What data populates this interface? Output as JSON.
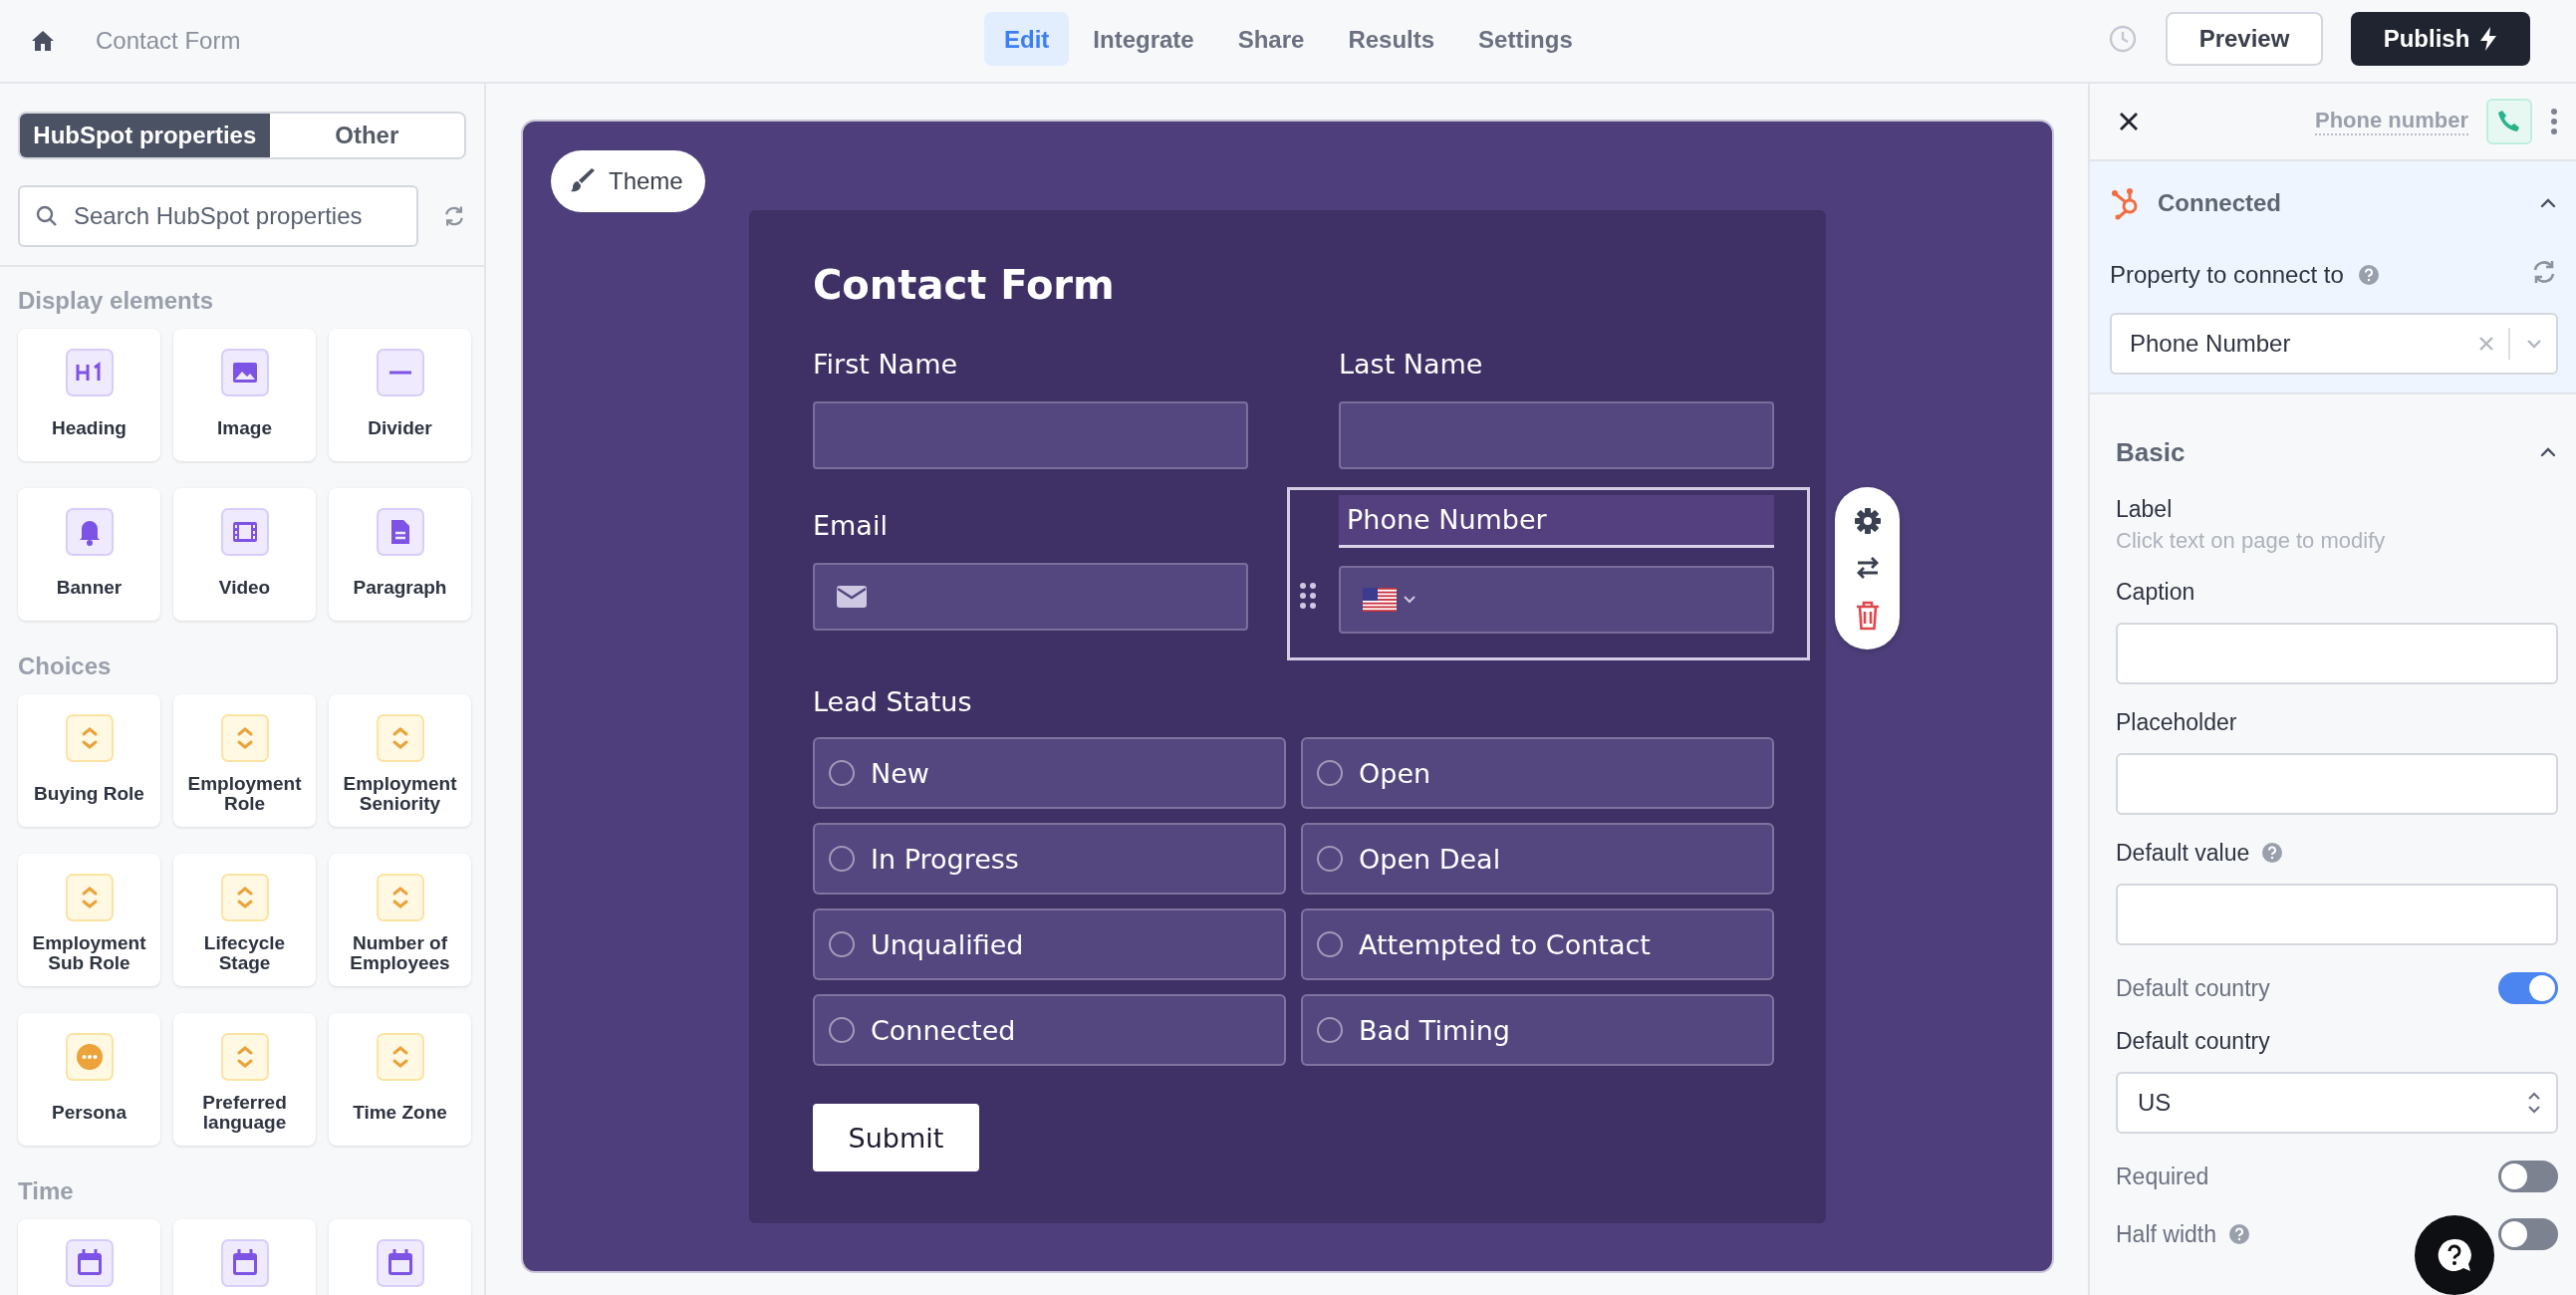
{
  "topbar": {
    "title": "Contact Form",
    "tabs": [
      {
        "label": "Edit",
        "selected": true
      },
      {
        "label": "Integrate",
        "selected": false
      },
      {
        "label": "Share",
        "selected": false
      },
      {
        "label": "Results",
        "selected": false
      },
      {
        "label": "Settings",
        "selected": false
      }
    ],
    "preview": "Preview",
    "publish": "Publish"
  },
  "sidebar": {
    "tabs": [
      {
        "label": "HubSpot properties",
        "selected": true
      },
      {
        "label": "Other",
        "selected": false
      }
    ],
    "search": {
      "placeholder": "Search HubSpot properties"
    },
    "sections": [
      {
        "title": "Display elements",
        "items": [
          {
            "label": "Heading",
            "kind": "heading"
          },
          {
            "label": "Image",
            "kind": "image"
          },
          {
            "label": "Divider",
            "kind": "divider"
          },
          {
            "label": "Banner",
            "kind": "banner"
          },
          {
            "label": "Video",
            "kind": "video"
          },
          {
            "label": "Paragraph",
            "kind": "paragraph"
          }
        ]
      },
      {
        "title": "Choices",
        "items": [
          {
            "label": "Buying Role",
            "kind": "choice"
          },
          {
            "label": "Employment Role",
            "kind": "choice"
          },
          {
            "label": "Employment Seniority",
            "kind": "choice"
          },
          {
            "label": "Employment Sub Role",
            "kind": "choice"
          },
          {
            "label": "Lifecycle Stage",
            "kind": "choice"
          },
          {
            "label": "Number of Employees",
            "kind": "choice"
          },
          {
            "label": "Persona",
            "kind": "persona"
          },
          {
            "label": "Preferred language",
            "kind": "choice"
          },
          {
            "label": "Time Zone",
            "kind": "choice"
          }
        ]
      },
      {
        "title": "Time",
        "items": [
          {
            "kind": "date"
          },
          {
            "kind": "date"
          },
          {
            "kind": "date"
          }
        ]
      }
    ]
  },
  "form": {
    "theme": "Theme",
    "title": "Contact Form",
    "fields": [
      {
        "label": "First Name",
        "kind": "text",
        "selected": false
      },
      {
        "label": "Last Name",
        "kind": "text",
        "selected": false
      },
      {
        "label": "Email",
        "kind": "email",
        "selected": false
      },
      {
        "label": "Phone Number",
        "kind": "phone",
        "selected": true
      }
    ],
    "choice_group": {
      "label": "Lead Status",
      "options": [
        {
          "label": "New",
          "checked": false
        },
        {
          "label": "Open",
          "checked": false
        },
        {
          "label": "In Progress",
          "checked": false
        },
        {
          "label": "Open Deal",
          "checked": false
        },
        {
          "label": "Unqualified",
          "checked": false
        },
        {
          "label": "Attempted to Contact",
          "checked": false
        },
        {
          "label": "Connected",
          "checked": false
        },
        {
          "label": "Bad Timing",
          "checked": false
        }
      ]
    },
    "submit": "Submit"
  },
  "panel": {
    "field_name": "Phone number",
    "connection": {
      "status": "Connected",
      "expanded": true,
      "property_label": "Property to connect to",
      "property_value": "Phone Number"
    },
    "basic": {
      "title": "Basic",
      "expanded": true,
      "settings": [
        {
          "kind": "note",
          "label": "Label",
          "hint": "Click text on page to modify"
        },
        {
          "kind": "input",
          "label": "Caption"
        },
        {
          "kind": "input",
          "label": "Placeholder"
        },
        {
          "kind": "input",
          "label": "Default value",
          "help": true
        },
        {
          "kind": "toggle",
          "label": "Default country",
          "on": true
        },
        {
          "kind": "select",
          "label": "Default country",
          "value": "US"
        },
        {
          "kind": "toggle",
          "label": "Required",
          "on": false
        },
        {
          "kind": "toggle",
          "label": "Half width",
          "on": false,
          "help": true
        }
      ]
    }
  }
}
